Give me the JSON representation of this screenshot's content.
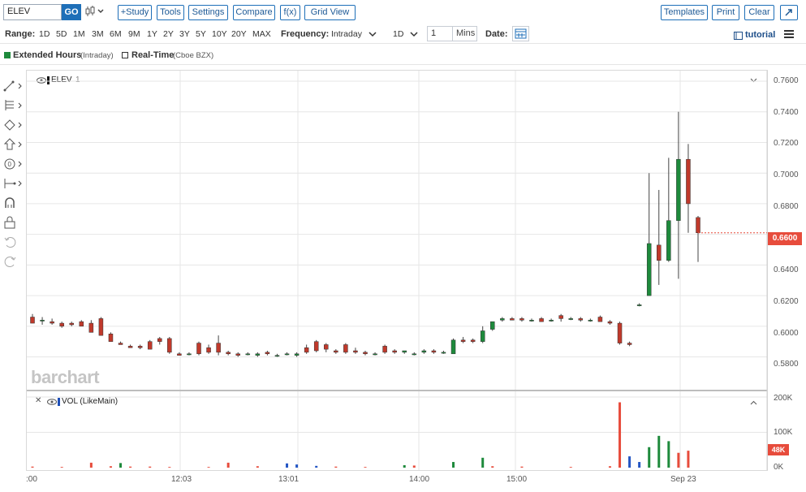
{
  "toolbar": {
    "symbol_value": "ELEV",
    "go_label": "GO",
    "buttons": {
      "study": "+Study",
      "tools": "Tools",
      "settings": "Settings",
      "compare": "Compare",
      "fx": "f(x)",
      "grid_view": "Grid View"
    },
    "right_buttons": {
      "templates": "Templates",
      "print": "Print",
      "clear": "Clear"
    }
  },
  "range_bar": {
    "range_label": "Range:",
    "ranges": [
      "1D",
      "5D",
      "1M",
      "3M",
      "6M",
      "9M",
      "1Y",
      "2Y",
      "3Y",
      "5Y",
      "10Y",
      "20Y",
      "MAX"
    ],
    "frequency_label": "Frequency:",
    "frequency_value": "Intraday",
    "period_value": "1D",
    "interval_value": "1",
    "interval_unit": "Mins",
    "date_label": "Date:",
    "tutorial_label": "tutorial"
  },
  "legend": {
    "extended_label": "Extended Hours",
    "extended_note": "(Intraday)",
    "realtime_label": "Real-Time",
    "realtime_note": "(Cboe BZX)",
    "colors": {
      "extended": "#1e8a3c",
      "realtime": "#ffffff"
    }
  },
  "price_pane": {
    "title": "ELEV",
    "title_suffix": "1",
    "last_price_tag": "0.6600",
    "watermark": "barchart"
  },
  "volume_pane": {
    "title": "VOL (LikeMain)",
    "last_volume_tag": "48K"
  },
  "colors": {
    "up": "#1e8a3c",
    "down": "#c0392b",
    "accent": "#1e6fb8",
    "tag": "#e74c3c"
  },
  "chart_data": {
    "type": "candlestick",
    "price_axis": {
      "ticks": [
        "0.7600",
        "0.7400",
        "0.7200",
        "0.7000",
        "0.6800",
        "0.6600",
        "0.6400",
        "0.6200",
        "0.6000",
        "0.5800"
      ],
      "ylim": [
        0.575,
        0.76
      ]
    },
    "volume_axis": {
      "ticks": [
        "200K",
        "100K",
        "0K"
      ],
      "ylim": [
        0,
        200000
      ]
    },
    "x_ticks": [
      ":00",
      "12:03",
      "13:01",
      "14:00",
      "15:00",
      "Sep 23"
    ],
    "candles": [
      {
        "x": 0,
        "o": 0.606,
        "h": 0.608,
        "l": 0.602,
        "c": 0.602
      },
      {
        "x": 1,
        "o": 0.604,
        "h": 0.606,
        "l": 0.601,
        "c": 0.604
      },
      {
        "x": 2,
        "o": 0.603,
        "h": 0.605,
        "l": 0.601,
        "c": 0.602
      },
      {
        "x": 3,
        "o": 0.602,
        "h": 0.603,
        "l": 0.599,
        "c": 0.6
      },
      {
        "x": 4,
        "o": 0.602,
        "h": 0.603,
        "l": 0.6,
        "c": 0.601
      },
      {
        "x": 5,
        "o": 0.603,
        "h": 0.604,
        "l": 0.6,
        "c": 0.6
      },
      {
        "x": 6,
        "o": 0.602,
        "h": 0.604,
        "l": 0.596,
        "c": 0.596
      },
      {
        "x": 7,
        "o": 0.605,
        "h": 0.606,
        "l": 0.594,
        "c": 0.594
      },
      {
        "x": 8,
        "o": 0.595,
        "h": 0.596,
        "l": 0.59,
        "c": 0.59
      },
      {
        "x": 9,
        "o": 0.589,
        "h": 0.59,
        "l": 0.588,
        "c": 0.588
      },
      {
        "x": 10,
        "o": 0.587,
        "h": 0.588,
        "l": 0.586,
        "c": 0.586
      },
      {
        "x": 11,
        "o": 0.587,
        "h": 0.588,
        "l": 0.585,
        "c": 0.586
      },
      {
        "x": 12,
        "o": 0.59,
        "h": 0.591,
        "l": 0.585,
        "c": 0.585
      },
      {
        "x": 13,
        "o": 0.592,
        "h": 0.593,
        "l": 0.588,
        "c": 0.59
      },
      {
        "x": 14,
        "o": 0.592,
        "h": 0.593,
        "l": 0.582,
        "c": 0.583
      },
      {
        "x": 15,
        "o": 0.582,
        "h": 0.583,
        "l": 0.581,
        "c": 0.581
      },
      {
        "x": 16,
        "o": 0.582,
        "h": 0.583,
        "l": 0.581,
        "c": 0.582
      },
      {
        "x": 17,
        "o": 0.589,
        "h": 0.59,
        "l": 0.581,
        "c": 0.582
      },
      {
        "x": 18,
        "o": 0.586,
        "h": 0.588,
        "l": 0.582,
        "c": 0.583
      },
      {
        "x": 19,
        "o": 0.589,
        "h": 0.594,
        "l": 0.581,
        "c": 0.583
      },
      {
        "x": 20,
        "o": 0.583,
        "h": 0.584,
        "l": 0.581,
        "c": 0.582
      },
      {
        "x": 21,
        "o": 0.582,
        "h": 0.583,
        "l": 0.58,
        "c": 0.581
      },
      {
        "x": 22,
        "o": 0.582,
        "h": 0.583,
        "l": 0.581,
        "c": 0.582
      },
      {
        "x": 23,
        "o": 0.581,
        "h": 0.583,
        "l": 0.58,
        "c": 0.582
      },
      {
        "x": 24,
        "o": 0.583,
        "h": 0.584,
        "l": 0.581,
        "c": 0.582
      },
      {
        "x": 25,
        "o": 0.581,
        "h": 0.582,
        "l": 0.58,
        "c": 0.581
      },
      {
        "x": 26,
        "o": 0.582,
        "h": 0.583,
        "l": 0.581,
        "c": 0.582
      },
      {
        "x": 27,
        "o": 0.581,
        "h": 0.583,
        "l": 0.58,
        "c": 0.582
      },
      {
        "x": 28,
        "o": 0.586,
        "h": 0.588,
        "l": 0.582,
        "c": 0.583
      },
      {
        "x": 29,
        "o": 0.59,
        "h": 0.591,
        "l": 0.583,
        "c": 0.584
      },
      {
        "x": 30,
        "o": 0.588,
        "h": 0.589,
        "l": 0.583,
        "c": 0.585
      },
      {
        "x": 31,
        "o": 0.584,
        "h": 0.585,
        "l": 0.582,
        "c": 0.583
      },
      {
        "x": 32,
        "o": 0.588,
        "h": 0.589,
        "l": 0.582,
        "c": 0.583
      },
      {
        "x": 33,
        "o": 0.584,
        "h": 0.586,
        "l": 0.582,
        "c": 0.583
      },
      {
        "x": 34,
        "o": 0.583,
        "h": 0.584,
        "l": 0.581,
        "c": 0.582
      },
      {
        "x": 35,
        "o": 0.582,
        "h": 0.583,
        "l": 0.581,
        "c": 0.582
      },
      {
        "x": 36,
        "o": 0.587,
        "h": 0.588,
        "l": 0.582,
        "c": 0.583
      },
      {
        "x": 37,
        "o": 0.584,
        "h": 0.585,
        "l": 0.582,
        "c": 0.583
      },
      {
        "x": 38,
        "o": 0.583,
        "h": 0.584,
        "l": 0.582,
        "c": 0.584
      },
      {
        "x": 39,
        "o": 0.582,
        "h": 0.583,
        "l": 0.581,
        "c": 0.582
      },
      {
        "x": 40,
        "o": 0.583,
        "h": 0.585,
        "l": 0.582,
        "c": 0.584
      },
      {
        "x": 41,
        "o": 0.584,
        "h": 0.585,
        "l": 0.582,
        "c": 0.583
      },
      {
        "x": 42,
        "o": 0.583,
        "h": 0.584,
        "l": 0.582,
        "c": 0.583
      },
      {
        "x": 43,
        "o": 0.582,
        "h": 0.592,
        "l": 0.582,
        "c": 0.591
      },
      {
        "x": 44,
        "o": 0.591,
        "h": 0.593,
        "l": 0.589,
        "c": 0.59
      },
      {
        "x": 45,
        "o": 0.591,
        "h": 0.592,
        "l": 0.589,
        "c": 0.59
      },
      {
        "x": 46,
        "o": 0.59,
        "h": 0.6,
        "l": 0.589,
        "c": 0.597
      },
      {
        "x": 47,
        "o": 0.598,
        "h": 0.603,
        "l": 0.597,
        "c": 0.603
      },
      {
        "x": 48,
        "o": 0.604,
        "h": 0.606,
        "l": 0.603,
        "c": 0.605
      },
      {
        "x": 49,
        "o": 0.605,
        "h": 0.606,
        "l": 0.604,
        "c": 0.604
      },
      {
        "x": 50,
        "o": 0.605,
        "h": 0.606,
        "l": 0.603,
        "c": 0.604
      },
      {
        "x": 51,
        "o": 0.604,
        "h": 0.605,
        "l": 0.603,
        "c": 0.604
      },
      {
        "x": 52,
        "o": 0.605,
        "h": 0.606,
        "l": 0.603,
        "c": 0.603
      },
      {
        "x": 53,
        "o": 0.604,
        "h": 0.605,
        "l": 0.603,
        "c": 0.604
      },
      {
        "x": 54,
        "o": 0.607,
        "h": 0.608,
        "l": 0.603,
        "c": 0.605
      },
      {
        "x": 55,
        "o": 0.605,
        "h": 0.606,
        "l": 0.604,
        "c": 0.605
      },
      {
        "x": 56,
        "o": 0.605,
        "h": 0.606,
        "l": 0.603,
        "c": 0.604
      },
      {
        "x": 57,
        "o": 0.604,
        "h": 0.605,
        "l": 0.603,
        "c": 0.604
      },
      {
        "x": 58,
        "o": 0.606,
        "h": 0.607,
        "l": 0.603,
        "c": 0.603
      },
      {
        "x": 59,
        "o": 0.603,
        "h": 0.604,
        "l": 0.601,
        "c": 0.602
      },
      {
        "x": 60,
        "o": 0.602,
        "h": 0.603,
        "l": 0.588,
        "c": 0.589
      },
      {
        "x": 61,
        "o": 0.589,
        "h": 0.59,
        "l": 0.587,
        "c": 0.588
      },
      {
        "x": 62,
        "o": 0.614,
        "h": 0.615,
        "l": 0.613,
        "c": 0.614
      },
      {
        "x": 63,
        "o": 0.62,
        "h": 0.7,
        "l": 0.62,
        "c": 0.654
      },
      {
        "x": 64,
        "o": 0.653,
        "h": 0.689,
        "l": 0.627,
        "c": 0.643
      },
      {
        "x": 65,
        "o": 0.643,
        "h": 0.71,
        "l": 0.642,
        "c": 0.669
      },
      {
        "x": 66,
        "o": 0.669,
        "h": 0.74,
        "l": 0.631,
        "c": 0.709
      },
      {
        "x": 67,
        "o": 0.709,
        "h": 0.719,
        "l": 0.661,
        "c": 0.68
      },
      {
        "x": 68,
        "o": 0.671,
        "h": 0.672,
        "l": 0.642,
        "c": 0.661
      }
    ],
    "volumes": [
      {
        "x": 0,
        "v": 3000,
        "d": "down"
      },
      {
        "x": 3,
        "v": 2000,
        "d": "down"
      },
      {
        "x": 6,
        "v": 14000,
        "d": "down"
      },
      {
        "x": 8,
        "v": 4000,
        "d": "down"
      },
      {
        "x": 9,
        "v": 13000,
        "d": "up"
      },
      {
        "x": 10,
        "v": 3000,
        "d": "down"
      },
      {
        "x": 12,
        "v": 3000,
        "d": "down"
      },
      {
        "x": 14,
        "v": 2000,
        "d": "down"
      },
      {
        "x": 18,
        "v": 2000,
        "d": "down"
      },
      {
        "x": 20,
        "v": 14000,
        "d": "down"
      },
      {
        "x": 23,
        "v": 4000,
        "d": "down"
      },
      {
        "x": 26,
        "v": 12000,
        "d": "blue"
      },
      {
        "x": 27,
        "v": 9000,
        "d": "blue"
      },
      {
        "x": 29,
        "v": 5000,
        "d": "blue"
      },
      {
        "x": 31,
        "v": 3000,
        "d": "down"
      },
      {
        "x": 34,
        "v": 2000,
        "d": "down"
      },
      {
        "x": 38,
        "v": 7000,
        "d": "up"
      },
      {
        "x": 39,
        "v": 6000,
        "d": "down"
      },
      {
        "x": 43,
        "v": 16000,
        "d": "up"
      },
      {
        "x": 46,
        "v": 28000,
        "d": "up"
      },
      {
        "x": 47,
        "v": 4000,
        "d": "down"
      },
      {
        "x": 50,
        "v": 3000,
        "d": "down"
      },
      {
        "x": 55,
        "v": 2000,
        "d": "down"
      },
      {
        "x": 59,
        "v": 4000,
        "d": "down"
      },
      {
        "x": 60,
        "v": 185000,
        "d": "down"
      },
      {
        "x": 61,
        "v": 32000,
        "d": "blue"
      },
      {
        "x": 62,
        "v": 16000,
        "d": "blue"
      },
      {
        "x": 63,
        "v": 58000,
        "d": "up"
      },
      {
        "x": 64,
        "v": 90000,
        "d": "up"
      },
      {
        "x": 65,
        "v": 75000,
        "d": "up"
      },
      {
        "x": 66,
        "v": 42000,
        "d": "down"
      },
      {
        "x": 67,
        "v": 48000,
        "d": "down"
      }
    ]
  }
}
